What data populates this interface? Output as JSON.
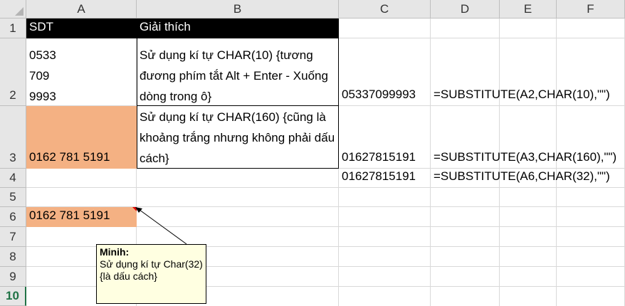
{
  "columns": [
    "A",
    "B",
    "C",
    "D",
    "E",
    "F"
  ],
  "rows": [
    "1",
    "2",
    "3",
    "4",
    "5",
    "6",
    "7",
    "8",
    "9",
    "10"
  ],
  "cells": {
    "A1": "SDT",
    "B1": "Giải thích",
    "A2_lines": [
      "0533",
      "709",
      "9993"
    ],
    "B2": "Sử dụng kí tự CHAR(10) {tương đương phím tắt Alt + Enter - Xuống dòng trong ô}",
    "C2": "05337099993",
    "D2": "=SUBSTITUTE(A2,CHAR(10),\"\")",
    "A3": "0162 781 5191",
    "B3": "Sử dụng kí tự CHAR(160) {cũng là khoảng trắng nhưng không phải dấu cách}",
    "C3": "01627815191",
    "D3": "=SUBSTITUTE(A3,CHAR(160),\"\")",
    "C4": "01627815191",
    "D4": "=SUBSTITUTE(A6,CHAR(32),\"\")",
    "A6": "0162 781 5191"
  },
  "comment": {
    "author": "Minih:",
    "text": "Sử dụng kí tự Char(32) {là dấu cách}"
  },
  "colors": {
    "header_bg": "#e6e6e6",
    "selected_row_header": "#217346",
    "salmon_fill": "#f4b183",
    "comment_bg": "#ffffe1"
  }
}
